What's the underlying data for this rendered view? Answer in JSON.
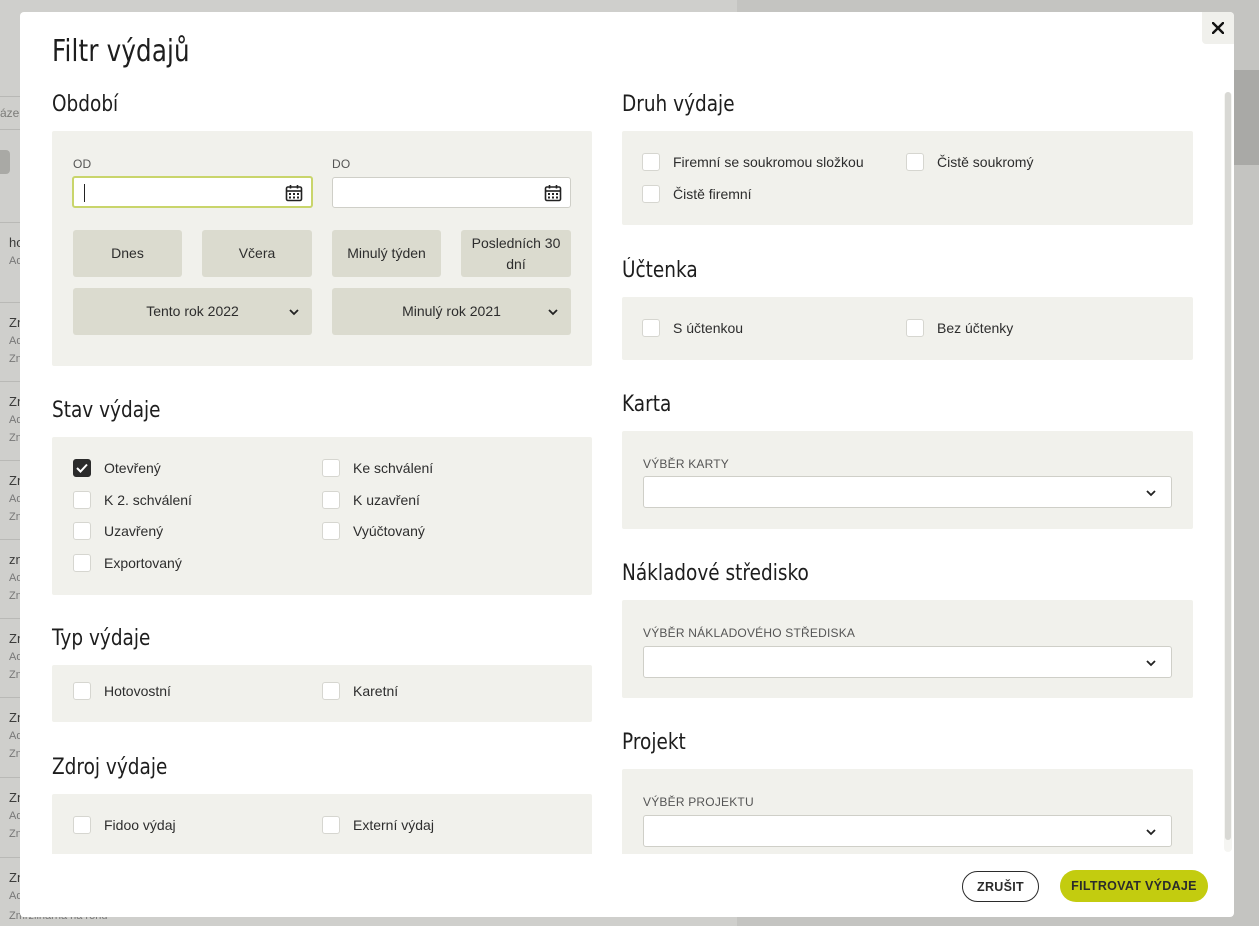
{
  "background": {
    "search_placeholder": "ázeni",
    "rows": [
      {
        "t1": "ho",
        "t2": "Ad",
        "t3": ""
      },
      {
        "t1": "Zn",
        "t2": "Ad",
        "t3": "Zn"
      },
      {
        "t1": "Zn",
        "t2": "Ad",
        "t3": "Zn"
      },
      {
        "t1": "Zn",
        "t2": "Ad",
        "t3": "Zn"
      },
      {
        "t1": "zn",
        "t2": "Ad",
        "t3": "Zn"
      },
      {
        "t1": "Zn",
        "t2": "Ad",
        "t3": "Zn"
      },
      {
        "t1": "Zn",
        "t2": "Ad",
        "t3": "Zn"
      },
      {
        "t1": "Zn",
        "t2": "Ad",
        "t3": "Zn"
      },
      {
        "t1": "Zn",
        "t2": "Ad",
        "t3": ""
      }
    ],
    "bottom_text": "Zmrzlinárna na rohu"
  },
  "modal": {
    "title": "Filtr výdajů",
    "close_icon": "close-icon"
  },
  "obdobi": {
    "title": "Období",
    "od_label": "OD",
    "do_label": "DO",
    "od_value": "",
    "do_value": "",
    "quick": [
      "Dnes",
      "Včera",
      "Minulý týden",
      "Posledních 30 dní"
    ],
    "year_this": "Tento rok 2022",
    "year_last": "Minulý rok 2021"
  },
  "stav": {
    "title": "Stav výdaje",
    "items": [
      {
        "label": "Otevřený",
        "checked": true
      },
      {
        "label": "Ke schválení",
        "checked": false
      },
      {
        "label": "K 2. schválení",
        "checked": false
      },
      {
        "label": "K uzavření",
        "checked": false
      },
      {
        "label": "Uzavřený",
        "checked": false
      },
      {
        "label": "Vyúčtovaný",
        "checked": false
      },
      {
        "label": "Exportovaný",
        "checked": false
      }
    ]
  },
  "typ": {
    "title": "Typ výdaje",
    "items": [
      {
        "label": "Hotovostní",
        "checked": false
      },
      {
        "label": "Karetní",
        "checked": false
      }
    ]
  },
  "zdroj": {
    "title": "Zdroj výdaje",
    "items": [
      {
        "label": "Fidoo výdaj",
        "checked": false
      },
      {
        "label": "Externí výdaj",
        "checked": false
      }
    ]
  },
  "druh": {
    "title": "Druh výdaje",
    "items": [
      {
        "label": "Firemní se soukromou složkou",
        "checked": false
      },
      {
        "label": "Čistě soukromý",
        "checked": false
      },
      {
        "label": "Čistě firemní",
        "checked": false
      }
    ]
  },
  "uctenka": {
    "title": "Účtenka",
    "items": [
      {
        "label": "S účtenkou",
        "checked": false
      },
      {
        "label": "Bez účtenky",
        "checked": false
      }
    ]
  },
  "karta": {
    "title": "Karta",
    "label": "VÝBĚR KARTY",
    "value": ""
  },
  "stredisko": {
    "title": "Nákladové středisko",
    "label": "VÝBĚR NÁKLADOVÉHO STŘEDISKA",
    "value": ""
  },
  "projekt": {
    "title": "Projekt",
    "label": "VÝBĚR PROJEKTU",
    "value": ""
  },
  "footer": {
    "cancel": "ZRUŠIT",
    "submit": "FILTROVAT VÝDAJE"
  },
  "colors": {
    "accent": "#c3cc0f",
    "panel": "#f1f1ec",
    "quick_button": "#dbdbcf"
  }
}
